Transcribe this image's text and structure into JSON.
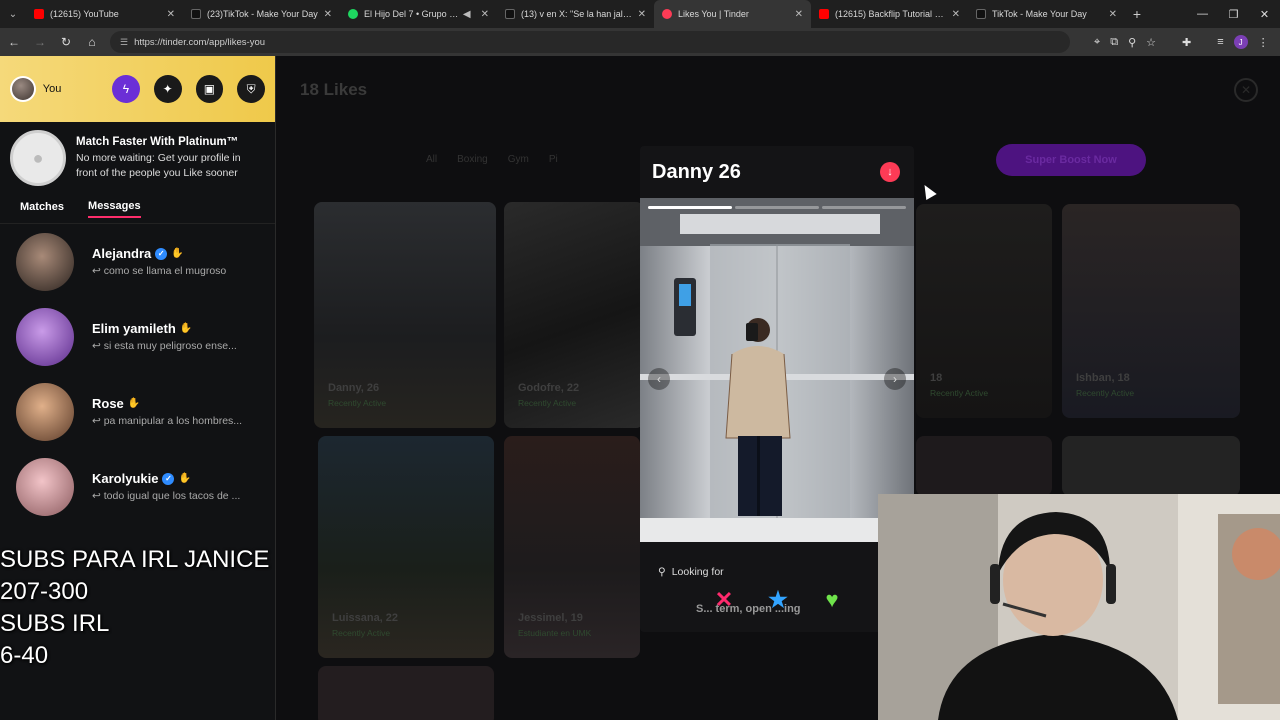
{
  "browser": {
    "tabs": [
      {
        "title": "(12615) YouTube",
        "color": "#ff0000",
        "active": false
      },
      {
        "title": "(23)TikTok - Make Your Day",
        "color": "#111111",
        "active": false
      },
      {
        "title": "El Hijo Del 7 • Grupo 360",
        "color": "#1ed760",
        "active": false
      },
      {
        "title": "(13) v en X: \"Se la han jalado c",
        "color": "#111111",
        "active": false
      },
      {
        "title": "Likes You | Tinder",
        "color": "#fd3b56",
        "active": true
      },
      {
        "title": "(12615) Backflip Tutorial 🔥 Ap",
        "color": "#ff0000",
        "active": false
      },
      {
        "title": "TikTok - Make Your Day",
        "color": "#111111",
        "active": false
      }
    ],
    "url": "https://tinder.com/app/likes-you",
    "profile_initial": "J"
  },
  "sidebar": {
    "user_name": "You",
    "promo": {
      "title": "Match Faster With Platinum™",
      "description": "No more waiting: Get your profile in front of the people you Like sooner"
    },
    "tabs": {
      "matches": "Matches",
      "messages": "Messages"
    },
    "messages": [
      {
        "name": "Alejandra",
        "verified": true,
        "preview": "como se llama el mugroso"
      },
      {
        "name": "Elim yamileth",
        "verified": false,
        "preview": "si esta muy peligroso ense..."
      },
      {
        "name": "Rose",
        "verified": false,
        "preview": "pa manipular a los hombres..."
      },
      {
        "name": "Karolyukie",
        "verified": true,
        "preview": "todo igual que los tacos de ..."
      }
    ]
  },
  "main": {
    "likes_title": "18 Likes",
    "filters": [
      "All",
      "Boxing",
      "Gym",
      "Pi"
    ],
    "boost_label": "Super Boost Now",
    "cards": [
      {
        "caption": "Danny, 26",
        "status": "Recently Active"
      },
      {
        "caption": "Godofre, 22",
        "status": "Recently Active"
      },
      {
        "caption": "18",
        "status": "Recently Active"
      },
      {
        "caption": "Ishban, 18",
        "status": "Recently Active"
      },
      {
        "caption": "Luissana, 22",
        "status": "Recently Active"
      },
      {
        "caption": "Jessimel, 19",
        "status": "Estudiante en UMK"
      }
    ]
  },
  "profile_modal": {
    "name": "Danny 26",
    "photo_count": 3,
    "current_photo": 1,
    "looking_for_label": "Looking for",
    "looking_for_value": "S... term, open ...ing"
  },
  "overlay": {
    "line1": "SUBS PARA IRL JANICE",
    "line2": "207-300",
    "line3": "SUBS IRL",
    "line4": "6-40"
  },
  "colors": {
    "tinder_pink": "#fd2d6b",
    "platinum_gold": "#efc94a",
    "super_like": "#32a4ff",
    "like": "#6fe34b"
  }
}
